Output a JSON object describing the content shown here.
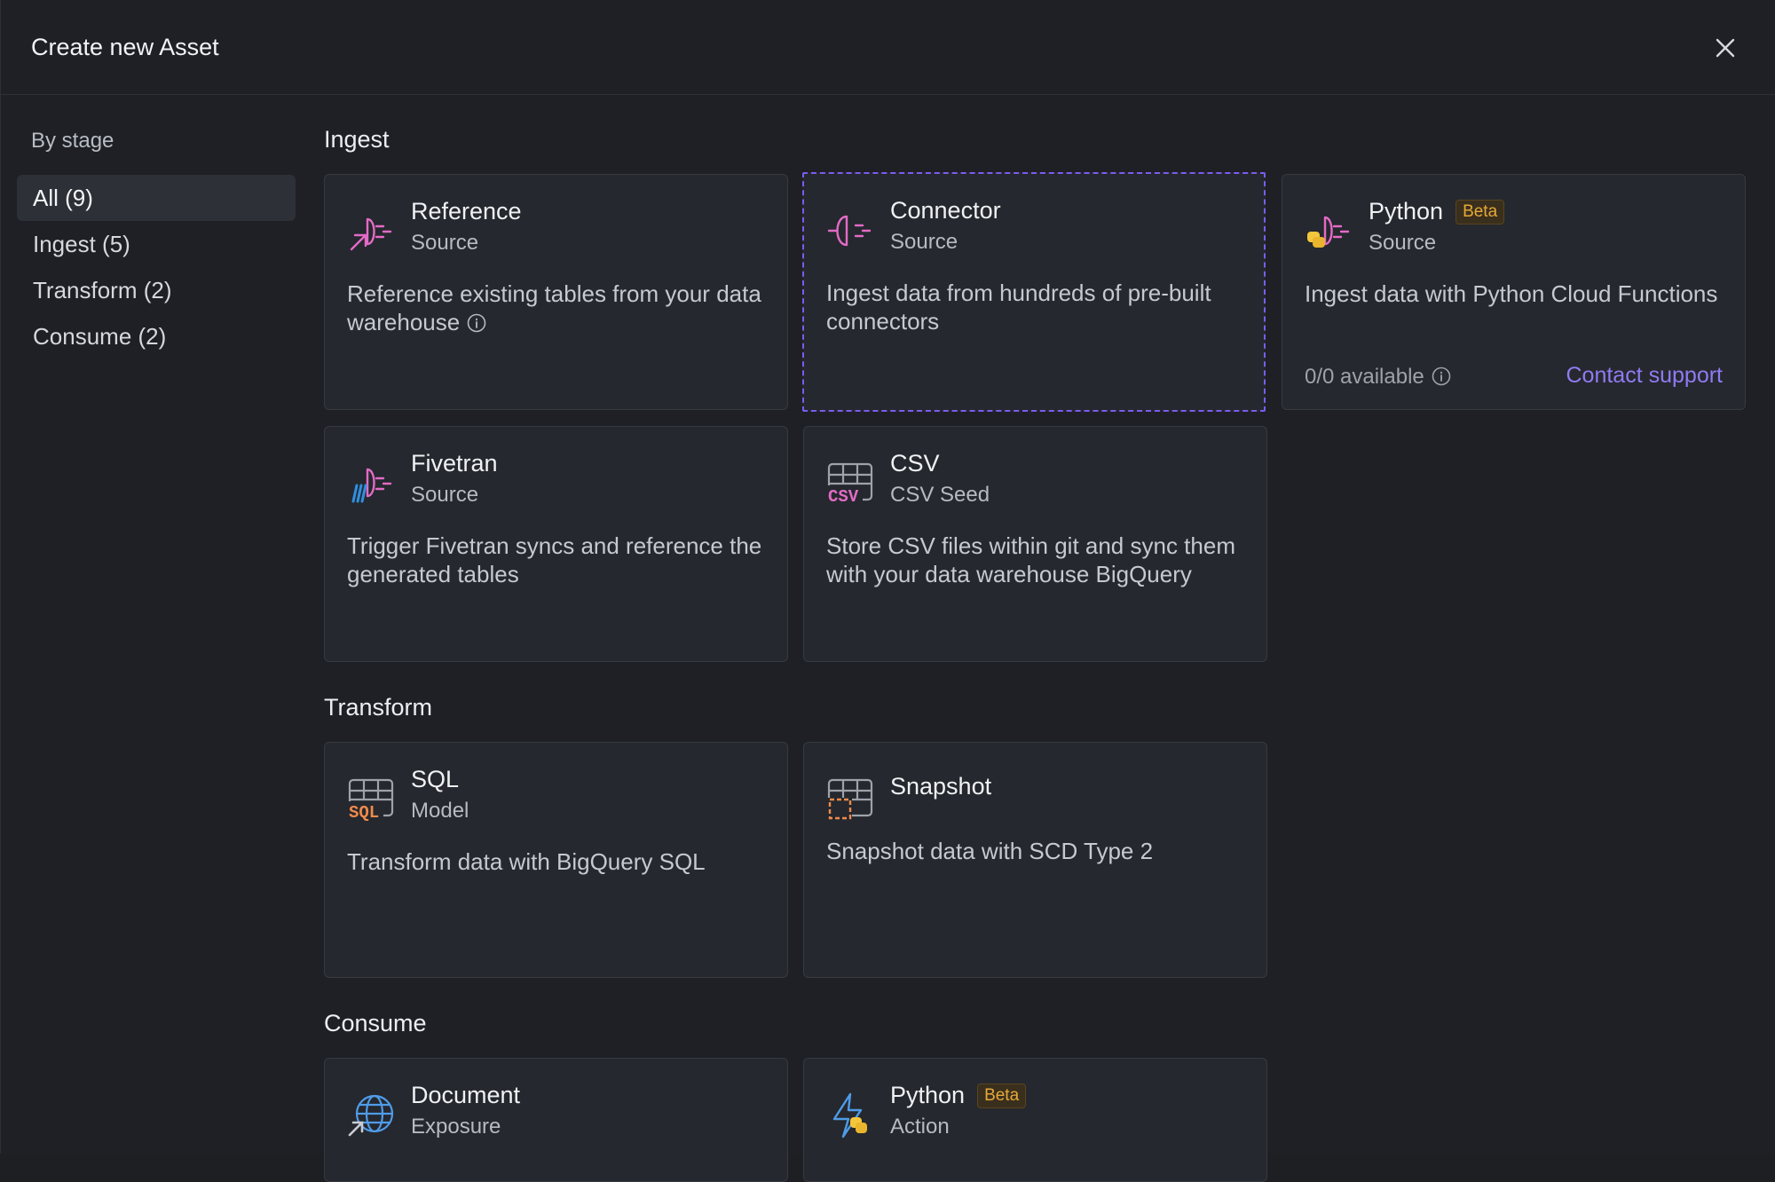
{
  "dialog": {
    "title": "Create new Asset"
  },
  "sidebar": {
    "heading": "By stage",
    "items": [
      {
        "label": "All (9)"
      },
      {
        "label": "Ingest (5)"
      },
      {
        "label": "Transform (2)"
      },
      {
        "label": "Consume (2)"
      }
    ]
  },
  "sections": {
    "ingest": {
      "title": "Ingest",
      "cards": [
        {
          "name": "Reference",
          "sub": "Source",
          "desc": "Reference existing tables from your data warehouse",
          "icon": "reference-source-icon"
        },
        {
          "name": "Connector",
          "sub": "Source",
          "desc": "Ingest data from hundreds of pre-built connectors",
          "icon": "connector-plug-icon"
        },
        {
          "name": "Python",
          "badge": "Beta",
          "sub": "Source",
          "desc": "Ingest data with Python Cloud Functions",
          "availability": "0/0 available",
          "link": "Contact support",
          "icon": "python-source-icon"
        },
        {
          "name": "Fivetran",
          "sub": "Source",
          "desc": "Trigger Fivetran syncs and reference the generated tables",
          "icon": "fivetran-icon"
        },
        {
          "name": "CSV",
          "sub": "CSV Seed",
          "desc": "Store CSV files within git and sync them with your data warehouse BigQuery",
          "icon": "csv-seed-icon"
        }
      ]
    },
    "transform": {
      "title": "Transform",
      "cards": [
        {
          "name": "SQL",
          "sub": "Model",
          "desc": "Transform data with BigQuery SQL",
          "icon": "sql-model-icon"
        },
        {
          "name": "Snapshot",
          "desc": "Snapshot data with SCD Type 2",
          "icon": "snapshot-icon"
        }
      ]
    },
    "consume": {
      "title": "Consume",
      "cards": [
        {
          "name": "Document",
          "sub": "Exposure",
          "icon": "globe-exposure-icon"
        },
        {
          "name": "Python",
          "badge": "Beta",
          "sub": "Action",
          "icon": "python-action-icon"
        }
      ]
    }
  },
  "colors": {
    "accent": "#7b5cf0",
    "link": "#8f7bf3",
    "beta": "#e6a93a",
    "pink": "#e36bc6",
    "orange": "#f08a4b"
  }
}
